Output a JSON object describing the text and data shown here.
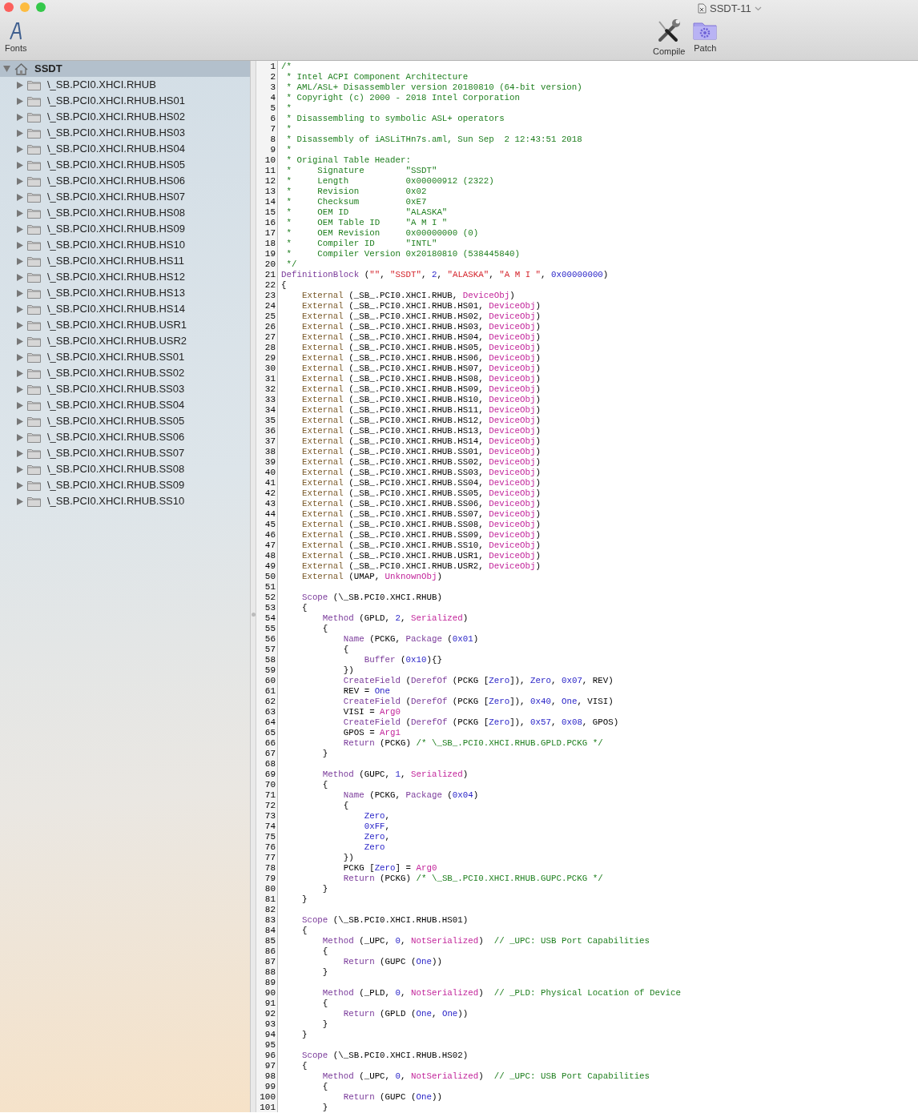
{
  "window": {
    "title": "SSDT-11"
  },
  "toolbar": {
    "left_items": [
      {
        "label": "Fonts",
        "kind": "fonts"
      }
    ],
    "right_items": [
      {
        "label": "Compile",
        "kind": "compile"
      },
      {
        "label": "Patch",
        "kind": "patch"
      }
    ]
  },
  "sidebar": {
    "tree": {
      "label": "SSDT",
      "expanded": true,
      "selected": true,
      "children": [
        {
          "label": "\\_SB.PCI0.XHCI.RHUB",
          "expanded": false,
          "selected": false
        },
        {
          "label": "\\_SB.PCI0.XHCI.RHUB.HS01",
          "expanded": false,
          "selected": false
        },
        {
          "label": "\\_SB.PCI0.XHCI.RHUB.HS02",
          "expanded": false,
          "selected": false
        },
        {
          "label": "\\_SB.PCI0.XHCI.RHUB.HS03",
          "expanded": false,
          "selected": false
        },
        {
          "label": "\\_SB.PCI0.XHCI.RHUB.HS04",
          "expanded": false,
          "selected": false
        },
        {
          "label": "\\_SB.PCI0.XHCI.RHUB.HS05",
          "expanded": false,
          "selected": false
        },
        {
          "label": "\\_SB.PCI0.XHCI.RHUB.HS06",
          "expanded": false,
          "selected": false
        },
        {
          "label": "\\_SB.PCI0.XHCI.RHUB.HS07",
          "expanded": false,
          "selected": false
        },
        {
          "label": "\\_SB.PCI0.XHCI.RHUB.HS08",
          "expanded": false,
          "selected": false
        },
        {
          "label": "\\_SB.PCI0.XHCI.RHUB.HS09",
          "expanded": false,
          "selected": false
        },
        {
          "label": "\\_SB.PCI0.XHCI.RHUB.HS10",
          "expanded": false,
          "selected": false
        },
        {
          "label": "\\_SB.PCI0.XHCI.RHUB.HS11",
          "expanded": false,
          "selected": false
        },
        {
          "label": "\\_SB.PCI0.XHCI.RHUB.HS12",
          "expanded": false,
          "selected": false
        },
        {
          "label": "\\_SB.PCI0.XHCI.RHUB.HS13",
          "expanded": false,
          "selected": false
        },
        {
          "label": "\\_SB.PCI0.XHCI.RHUB.HS14",
          "expanded": false,
          "selected": false
        },
        {
          "label": "\\_SB.PCI0.XHCI.RHUB.USR1",
          "expanded": false,
          "selected": false
        },
        {
          "label": "\\_SB.PCI0.XHCI.RHUB.USR2",
          "expanded": false,
          "selected": false
        },
        {
          "label": "\\_SB.PCI0.XHCI.RHUB.SS01",
          "expanded": false,
          "selected": false
        },
        {
          "label": "\\_SB.PCI0.XHCI.RHUB.SS02",
          "expanded": false,
          "selected": false
        },
        {
          "label": "\\_SB.PCI0.XHCI.RHUB.SS03",
          "expanded": false,
          "selected": false
        },
        {
          "label": "\\_SB.PCI0.XHCI.RHUB.SS04",
          "expanded": false,
          "selected": false
        },
        {
          "label": "\\_SB.PCI0.XHCI.RHUB.SS05",
          "expanded": false,
          "selected": false
        },
        {
          "label": "\\_SB.PCI0.XHCI.RHUB.SS06",
          "expanded": false,
          "selected": false
        },
        {
          "label": "\\_SB.PCI0.XHCI.RHUB.SS07",
          "expanded": false,
          "selected": false
        },
        {
          "label": "\\_SB.PCI0.XHCI.RHUB.SS08",
          "expanded": false,
          "selected": false
        },
        {
          "label": "\\_SB.PCI0.XHCI.RHUB.SS09",
          "expanded": false,
          "selected": false
        },
        {
          "label": "\\_SB.PCI0.XHCI.RHUB.SS10",
          "expanded": false,
          "selected": false
        }
      ]
    }
  },
  "editor": {
    "lines": [
      {
        "number": "1",
        "tokens": [
          {
            "kind": "comment",
            "text": "/*"
          }
        ]
      },
      {
        "number": "2",
        "tokens": [
          {
            "kind": "comment",
            "text": " * Intel ACPI Component Architecture"
          }
        ]
      },
      {
        "number": "3",
        "tokens": [
          {
            "kind": "comment",
            "text": " * AML/ASL+ Disassembler version 20180810 (64-bit version)"
          }
        ]
      },
      {
        "number": "4",
        "tokens": [
          {
            "kind": "comment",
            "text": " * Copyright (c) 2000 - 2018 Intel Corporation"
          }
        ]
      },
      {
        "number": "5",
        "tokens": [
          {
            "kind": "comment",
            "text": " *"
          }
        ]
      },
      {
        "number": "6",
        "tokens": [
          {
            "kind": "comment",
            "text": " * Disassembling to symbolic ASL+ operators"
          }
        ]
      },
      {
        "number": "7",
        "tokens": [
          {
            "kind": "comment",
            "text": " *"
          }
        ]
      },
      {
        "number": "8",
        "tokens": [
          {
            "kind": "comment",
            "text": " * Disassembly of iASLiTHn7s.aml, Sun Sep  2 12:43:51 2018"
          }
        ]
      },
      {
        "number": "9",
        "tokens": [
          {
            "kind": "comment",
            "text": " *"
          }
        ]
      },
      {
        "number": "10",
        "tokens": [
          {
            "kind": "comment",
            "text": " * Original Table Header:"
          }
        ]
      },
      {
        "number": "11",
        "tokens": [
          {
            "kind": "comment",
            "text": " *     Signature        \"SSDT\""
          }
        ]
      },
      {
        "number": "12",
        "tokens": [
          {
            "kind": "comment",
            "text": " *     Length           0x00000912 (2322)"
          }
        ]
      },
      {
        "number": "13",
        "tokens": [
          {
            "kind": "comment",
            "text": " *     Revision         0x02"
          }
        ]
      },
      {
        "number": "14",
        "tokens": [
          {
            "kind": "comment",
            "text": " *     Checksum         0xE7"
          }
        ]
      },
      {
        "number": "15",
        "tokens": [
          {
            "kind": "comment",
            "text": " *     OEM ID           \"ALASKA\""
          }
        ]
      },
      {
        "number": "16",
        "tokens": [
          {
            "kind": "comment",
            "text": " *     OEM Table ID     \"A M I \""
          }
        ]
      },
      {
        "number": "17",
        "tokens": [
          {
            "kind": "comment",
            "text": " *     OEM Revision     0x00000000 (0)"
          }
        ]
      },
      {
        "number": "18",
        "tokens": [
          {
            "kind": "comment",
            "text": " *     Compiler ID      \"INTL\""
          }
        ]
      },
      {
        "number": "19",
        "tokens": [
          {
            "kind": "comment",
            "text": " *     Compiler Version 0x20180810 (538445840)"
          }
        ]
      },
      {
        "number": "20",
        "tokens": [
          {
            "kind": "comment",
            "text": " */"
          }
        ]
      },
      {
        "number": "21",
        "tokens": [
          {
            "kind": "keyword",
            "text": "DefinitionBlock"
          },
          {
            "kind": "plain",
            "text": " ("
          },
          {
            "kind": "string",
            "text": "\"\""
          },
          {
            "kind": "plain",
            "text": ", "
          },
          {
            "kind": "string",
            "text": "\"SSDT\""
          },
          {
            "kind": "plain",
            "text": ", "
          },
          {
            "kind": "number",
            "text": "2"
          },
          {
            "kind": "plain",
            "text": ", "
          },
          {
            "kind": "string",
            "text": "\"ALASKA\""
          },
          {
            "kind": "plain",
            "text": ", "
          },
          {
            "kind": "string",
            "text": "\"A M I \""
          },
          {
            "kind": "plain",
            "text": ", "
          },
          {
            "kind": "number",
            "text": "0x00000000"
          },
          {
            "kind": "plain",
            "text": ")"
          }
        ]
      },
      {
        "number": "22",
        "tokens": [
          {
            "kind": "plain",
            "text": "{"
          }
        ]
      },
      {
        "number": "23",
        "tokens": [
          {
            "kind": "directive",
            "text": "    External"
          },
          {
            "kind": "plain",
            "text": " (_SB_.PCI0.XHCI.RHUB, "
          },
          {
            "kind": "builtin",
            "text": "DeviceObj"
          },
          {
            "kind": "plain",
            "text": ")"
          }
        ]
      },
      {
        "number": "24",
        "tokens": [
          {
            "kind": "directive",
            "text": "    External"
          },
          {
            "kind": "plain",
            "text": " (_SB_.PCI0.XHCI.RHUB.HS01, "
          },
          {
            "kind": "builtin",
            "text": "DeviceObj"
          },
          {
            "kind": "plain",
            "text": ")"
          }
        ]
      },
      {
        "number": "25",
        "tokens": [
          {
            "kind": "directive",
            "text": "    External"
          },
          {
            "kind": "plain",
            "text": " (_SB_.PCI0.XHCI.RHUB.HS02, "
          },
          {
            "kind": "builtin",
            "text": "DeviceObj"
          },
          {
            "kind": "plain",
            "text": ")"
          }
        ]
      },
      {
        "number": "26",
        "tokens": [
          {
            "kind": "directive",
            "text": "    External"
          },
          {
            "kind": "plain",
            "text": " (_SB_.PCI0.XHCI.RHUB.HS03, "
          },
          {
            "kind": "builtin",
            "text": "DeviceObj"
          },
          {
            "kind": "plain",
            "text": ")"
          }
        ]
      },
      {
        "number": "27",
        "tokens": [
          {
            "kind": "directive",
            "text": "    External"
          },
          {
            "kind": "plain",
            "text": " (_SB_.PCI0.XHCI.RHUB.HS04, "
          },
          {
            "kind": "builtin",
            "text": "DeviceObj"
          },
          {
            "kind": "plain",
            "text": ")"
          }
        ]
      },
      {
        "number": "28",
        "tokens": [
          {
            "kind": "directive",
            "text": "    External"
          },
          {
            "kind": "plain",
            "text": " (_SB_.PCI0.XHCI.RHUB.HS05, "
          },
          {
            "kind": "builtin",
            "text": "DeviceObj"
          },
          {
            "kind": "plain",
            "text": ")"
          }
        ]
      },
      {
        "number": "29",
        "tokens": [
          {
            "kind": "directive",
            "text": "    External"
          },
          {
            "kind": "plain",
            "text": " (_SB_.PCI0.XHCI.RHUB.HS06, "
          },
          {
            "kind": "builtin",
            "text": "DeviceObj"
          },
          {
            "kind": "plain",
            "text": ")"
          }
        ]
      },
      {
        "number": "30",
        "tokens": [
          {
            "kind": "directive",
            "text": "    External"
          },
          {
            "kind": "plain",
            "text": " (_SB_.PCI0.XHCI.RHUB.HS07, "
          },
          {
            "kind": "builtin",
            "text": "DeviceObj"
          },
          {
            "kind": "plain",
            "text": ")"
          }
        ]
      },
      {
        "number": "31",
        "tokens": [
          {
            "kind": "directive",
            "text": "    External"
          },
          {
            "kind": "plain",
            "text": " (_SB_.PCI0.XHCI.RHUB.HS08, "
          },
          {
            "kind": "builtin",
            "text": "DeviceObj"
          },
          {
            "kind": "plain",
            "text": ")"
          }
        ]
      },
      {
        "number": "32",
        "tokens": [
          {
            "kind": "directive",
            "text": "    External"
          },
          {
            "kind": "plain",
            "text": " (_SB_.PCI0.XHCI.RHUB.HS09, "
          },
          {
            "kind": "builtin",
            "text": "DeviceObj"
          },
          {
            "kind": "plain",
            "text": ")"
          }
        ]
      },
      {
        "number": "33",
        "tokens": [
          {
            "kind": "directive",
            "text": "    External"
          },
          {
            "kind": "plain",
            "text": " (_SB_.PCI0.XHCI.RHUB.HS10, "
          },
          {
            "kind": "builtin",
            "text": "DeviceObj"
          },
          {
            "kind": "plain",
            "text": ")"
          }
        ]
      },
      {
        "number": "34",
        "tokens": [
          {
            "kind": "directive",
            "text": "    External"
          },
          {
            "kind": "plain",
            "text": " (_SB_.PCI0.XHCI.RHUB.HS11, "
          },
          {
            "kind": "builtin",
            "text": "DeviceObj"
          },
          {
            "kind": "plain",
            "text": ")"
          }
        ]
      },
      {
        "number": "35",
        "tokens": [
          {
            "kind": "directive",
            "text": "    External"
          },
          {
            "kind": "plain",
            "text": " (_SB_.PCI0.XHCI.RHUB.HS12, "
          },
          {
            "kind": "builtin",
            "text": "DeviceObj"
          },
          {
            "kind": "plain",
            "text": ")"
          }
        ]
      },
      {
        "number": "36",
        "tokens": [
          {
            "kind": "directive",
            "text": "    External"
          },
          {
            "kind": "plain",
            "text": " (_SB_.PCI0.XHCI.RHUB.HS13, "
          },
          {
            "kind": "builtin",
            "text": "DeviceObj"
          },
          {
            "kind": "plain",
            "text": ")"
          }
        ]
      },
      {
        "number": "37",
        "tokens": [
          {
            "kind": "directive",
            "text": "    External"
          },
          {
            "kind": "plain",
            "text": " (_SB_.PCI0.XHCI.RHUB.HS14, "
          },
          {
            "kind": "builtin",
            "text": "DeviceObj"
          },
          {
            "kind": "plain",
            "text": ")"
          }
        ]
      },
      {
        "number": "38",
        "tokens": [
          {
            "kind": "directive",
            "text": "    External"
          },
          {
            "kind": "plain",
            "text": " (_SB_.PCI0.XHCI.RHUB.SS01, "
          },
          {
            "kind": "builtin",
            "text": "DeviceObj"
          },
          {
            "kind": "plain",
            "text": ")"
          }
        ]
      },
      {
        "number": "39",
        "tokens": [
          {
            "kind": "directive",
            "text": "    External"
          },
          {
            "kind": "plain",
            "text": " (_SB_.PCI0.XHCI.RHUB.SS02, "
          },
          {
            "kind": "builtin",
            "text": "DeviceObj"
          },
          {
            "kind": "plain",
            "text": ")"
          }
        ]
      },
      {
        "number": "40",
        "tokens": [
          {
            "kind": "directive",
            "text": "    External"
          },
          {
            "kind": "plain",
            "text": " (_SB_.PCI0.XHCI.RHUB.SS03, "
          },
          {
            "kind": "builtin",
            "text": "DeviceObj"
          },
          {
            "kind": "plain",
            "text": ")"
          }
        ]
      },
      {
        "number": "41",
        "tokens": [
          {
            "kind": "directive",
            "text": "    External"
          },
          {
            "kind": "plain",
            "text": " (_SB_.PCI0.XHCI.RHUB.SS04, "
          },
          {
            "kind": "builtin",
            "text": "DeviceObj"
          },
          {
            "kind": "plain",
            "text": ")"
          }
        ]
      },
      {
        "number": "42",
        "tokens": [
          {
            "kind": "directive",
            "text": "    External"
          },
          {
            "kind": "plain",
            "text": " (_SB_.PCI0.XHCI.RHUB.SS05, "
          },
          {
            "kind": "builtin",
            "text": "DeviceObj"
          },
          {
            "kind": "plain",
            "text": ")"
          }
        ]
      },
      {
        "number": "43",
        "tokens": [
          {
            "kind": "directive",
            "text": "    External"
          },
          {
            "kind": "plain",
            "text": " (_SB_.PCI0.XHCI.RHUB.SS06, "
          },
          {
            "kind": "builtin",
            "text": "DeviceObj"
          },
          {
            "kind": "plain",
            "text": ")"
          }
        ]
      },
      {
        "number": "44",
        "tokens": [
          {
            "kind": "directive",
            "text": "    External"
          },
          {
            "kind": "plain",
            "text": " (_SB_.PCI0.XHCI.RHUB.SS07, "
          },
          {
            "kind": "builtin",
            "text": "DeviceObj"
          },
          {
            "kind": "plain",
            "text": ")"
          }
        ]
      },
      {
        "number": "45",
        "tokens": [
          {
            "kind": "directive",
            "text": "    External"
          },
          {
            "kind": "plain",
            "text": " (_SB_.PCI0.XHCI.RHUB.SS08, "
          },
          {
            "kind": "builtin",
            "text": "DeviceObj"
          },
          {
            "kind": "plain",
            "text": ")"
          }
        ]
      },
      {
        "number": "46",
        "tokens": [
          {
            "kind": "directive",
            "text": "    External"
          },
          {
            "kind": "plain",
            "text": " (_SB_.PCI0.XHCI.RHUB.SS09, "
          },
          {
            "kind": "builtin",
            "text": "DeviceObj"
          },
          {
            "kind": "plain",
            "text": ")"
          }
        ]
      },
      {
        "number": "47",
        "tokens": [
          {
            "kind": "directive",
            "text": "    External"
          },
          {
            "kind": "plain",
            "text": " (_SB_.PCI0.XHCI.RHUB.SS10, "
          },
          {
            "kind": "builtin",
            "text": "DeviceObj"
          },
          {
            "kind": "plain",
            "text": ")"
          }
        ]
      },
      {
        "number": "48",
        "tokens": [
          {
            "kind": "directive",
            "text": "    External"
          },
          {
            "kind": "plain",
            "text": " (_SB_.PCI0.XHCI.RHUB.USR1, "
          },
          {
            "kind": "builtin",
            "text": "DeviceObj"
          },
          {
            "kind": "plain",
            "text": ")"
          }
        ]
      },
      {
        "number": "49",
        "tokens": [
          {
            "kind": "directive",
            "text": "    External"
          },
          {
            "kind": "plain",
            "text": " (_SB_.PCI0.XHCI.RHUB.USR2, "
          },
          {
            "kind": "builtin",
            "text": "DeviceObj"
          },
          {
            "kind": "plain",
            "text": ")"
          }
        ]
      },
      {
        "number": "50",
        "tokens": [
          {
            "kind": "directive",
            "text": "    External"
          },
          {
            "kind": "plain",
            "text": " (UMAP, "
          },
          {
            "kind": "builtin",
            "text": "UnknownObj"
          },
          {
            "kind": "plain",
            "text": ")"
          }
        ]
      },
      {
        "number": "51"
      },
      {
        "number": "52",
        "tokens": [
          {
            "kind": "keyword",
            "text": "    Scope"
          },
          {
            "kind": "plain",
            "text": " (\\_SB.PCI0.XHCI.RHUB)"
          }
        ]
      },
      {
        "number": "53",
        "tokens": [
          {
            "kind": "plain",
            "text": "    {"
          }
        ]
      },
      {
        "number": "54",
        "tokens": [
          {
            "kind": "keyword",
            "text": "        Method"
          },
          {
            "kind": "plain",
            "text": " (GPLD, "
          },
          {
            "kind": "number",
            "text": "2"
          },
          {
            "kind": "plain",
            "text": ", "
          },
          {
            "kind": "builtin",
            "text": "Serialized"
          },
          {
            "kind": "plain",
            "text": ")"
          }
        ]
      },
      {
        "number": "55",
        "tokens": [
          {
            "kind": "plain",
            "text": "        {"
          }
        ]
      },
      {
        "number": "56",
        "tokens": [
          {
            "kind": "keyword",
            "text": "            Name"
          },
          {
            "kind": "plain",
            "text": " (PCKG, "
          },
          {
            "kind": "keyword",
            "text": "Package"
          },
          {
            "kind": "plain",
            "text": " ("
          },
          {
            "kind": "number",
            "text": "0x01"
          },
          {
            "kind": "plain",
            "text": ")"
          }
        ]
      },
      {
        "number": "57",
        "tokens": [
          {
            "kind": "plain",
            "text": "            {"
          }
        ]
      },
      {
        "number": "58",
        "tokens": [
          {
            "kind": "keyword",
            "text": "                Buffer"
          },
          {
            "kind": "plain",
            "text": " ("
          },
          {
            "kind": "number",
            "text": "0x10"
          },
          {
            "kind": "plain",
            "text": "){}"
          }
        ]
      },
      {
        "number": "59",
        "tokens": [
          {
            "kind": "plain",
            "text": "            })"
          }
        ]
      },
      {
        "number": "60",
        "tokens": [
          {
            "kind": "keyword",
            "text": "            CreateField"
          },
          {
            "kind": "plain",
            "text": " ("
          },
          {
            "kind": "keyword",
            "text": "DerefOf"
          },
          {
            "kind": "plain",
            "text": " (PCKG ["
          },
          {
            "kind": "number",
            "text": "Zero"
          },
          {
            "kind": "plain",
            "text": "]), "
          },
          {
            "kind": "number",
            "text": "Zero"
          },
          {
            "kind": "plain",
            "text": ", "
          },
          {
            "kind": "number",
            "text": "0x07"
          },
          {
            "kind": "plain",
            "text": ", REV)"
          }
        ]
      },
      {
        "number": "61",
        "tokens": [
          {
            "kind": "plain",
            "text": "            REV = "
          },
          {
            "kind": "number",
            "text": "One"
          }
        ]
      },
      {
        "number": "62",
        "tokens": [
          {
            "kind": "keyword",
            "text": "            CreateField"
          },
          {
            "kind": "plain",
            "text": " ("
          },
          {
            "kind": "keyword",
            "text": "DerefOf"
          },
          {
            "kind": "plain",
            "text": " (PCKG ["
          },
          {
            "kind": "number",
            "text": "Zero"
          },
          {
            "kind": "plain",
            "text": "]), "
          },
          {
            "kind": "number",
            "text": "0x40"
          },
          {
            "kind": "plain",
            "text": ", "
          },
          {
            "kind": "number",
            "text": "One"
          },
          {
            "kind": "plain",
            "text": ", VISI)"
          }
        ]
      },
      {
        "number": "63",
        "tokens": [
          {
            "kind": "plain",
            "text": "            VISI = "
          },
          {
            "kind": "builtin",
            "text": "Arg0"
          }
        ]
      },
      {
        "number": "64",
        "tokens": [
          {
            "kind": "keyword",
            "text": "            CreateField"
          },
          {
            "kind": "plain",
            "text": " ("
          },
          {
            "kind": "keyword",
            "text": "DerefOf"
          },
          {
            "kind": "plain",
            "text": " (PCKG ["
          },
          {
            "kind": "number",
            "text": "Zero"
          },
          {
            "kind": "plain",
            "text": "]), "
          },
          {
            "kind": "number",
            "text": "0x57"
          },
          {
            "kind": "plain",
            "text": ", "
          },
          {
            "kind": "number",
            "text": "0x08"
          },
          {
            "kind": "plain",
            "text": ", GPOS)"
          }
        ]
      },
      {
        "number": "65",
        "tokens": [
          {
            "kind": "plain",
            "text": "            GPOS = "
          },
          {
            "kind": "builtin",
            "text": "Arg1"
          }
        ]
      },
      {
        "number": "66",
        "tokens": [
          {
            "kind": "keyword",
            "text": "            Return"
          },
          {
            "kind": "plain",
            "text": " (PCKG) "
          },
          {
            "kind": "comment",
            "text": "/* \\_SB_.PCI0.XHCI.RHUB.GPLD.PCKG */"
          }
        ]
      },
      {
        "number": "67",
        "tokens": [
          {
            "kind": "plain",
            "text": "        }"
          }
        ]
      },
      {
        "number": "68"
      },
      {
        "number": "69",
        "tokens": [
          {
            "kind": "keyword",
            "text": "        Method"
          },
          {
            "kind": "plain",
            "text": " (GUPC, "
          },
          {
            "kind": "number",
            "text": "1"
          },
          {
            "kind": "plain",
            "text": ", "
          },
          {
            "kind": "builtin",
            "text": "Serialized"
          },
          {
            "kind": "plain",
            "text": ")"
          }
        ]
      },
      {
        "number": "70",
        "tokens": [
          {
            "kind": "plain",
            "text": "        {"
          }
        ]
      },
      {
        "number": "71",
        "tokens": [
          {
            "kind": "keyword",
            "text": "            Name"
          },
          {
            "kind": "plain",
            "text": " (PCKG, "
          },
          {
            "kind": "keyword",
            "text": "Package"
          },
          {
            "kind": "plain",
            "text": " ("
          },
          {
            "kind": "number",
            "text": "0x04"
          },
          {
            "kind": "plain",
            "text": ")"
          }
        ]
      },
      {
        "number": "72",
        "tokens": [
          {
            "kind": "plain",
            "text": "            {"
          }
        ]
      },
      {
        "number": "73",
        "tokens": [
          {
            "kind": "number",
            "text": "                Zero"
          },
          {
            "kind": "plain",
            "text": ","
          }
        ]
      },
      {
        "number": "74",
        "tokens": [
          {
            "kind": "number",
            "text": "                0xFF"
          },
          {
            "kind": "plain",
            "text": ","
          }
        ]
      },
      {
        "number": "75",
        "tokens": [
          {
            "kind": "number",
            "text": "                Zero"
          },
          {
            "kind": "plain",
            "text": ","
          }
        ]
      },
      {
        "number": "76",
        "tokens": [
          {
            "kind": "number",
            "text": "                Zero"
          }
        ]
      },
      {
        "number": "77",
        "tokens": [
          {
            "kind": "plain",
            "text": "            })"
          }
        ]
      },
      {
        "number": "78",
        "tokens": [
          {
            "kind": "plain",
            "text": "            PCKG ["
          },
          {
            "kind": "number",
            "text": "Zero"
          },
          {
            "kind": "plain",
            "text": "] = "
          },
          {
            "kind": "builtin",
            "text": "Arg0"
          }
        ]
      },
      {
        "number": "79",
        "tokens": [
          {
            "kind": "keyword",
            "text": "            Return"
          },
          {
            "kind": "plain",
            "text": " (PCKG) "
          },
          {
            "kind": "comment",
            "text": "/* \\_SB_.PCI0.XHCI.RHUB.GUPC.PCKG */"
          }
        ]
      },
      {
        "number": "80",
        "tokens": [
          {
            "kind": "plain",
            "text": "        }"
          }
        ]
      },
      {
        "number": "81",
        "tokens": [
          {
            "kind": "plain",
            "text": "    }"
          }
        ]
      },
      {
        "number": "82"
      },
      {
        "number": "83",
        "tokens": [
          {
            "kind": "keyword",
            "text": "    Scope"
          },
          {
            "kind": "plain",
            "text": " (\\_SB.PCI0.XHCI.RHUB.HS01)"
          }
        ]
      },
      {
        "number": "84",
        "tokens": [
          {
            "kind": "plain",
            "text": "    {"
          }
        ]
      },
      {
        "number": "85",
        "tokens": [
          {
            "kind": "keyword",
            "text": "        Method"
          },
          {
            "kind": "plain",
            "text": " (_UPC, "
          },
          {
            "kind": "number",
            "text": "0"
          },
          {
            "kind": "plain",
            "text": ", "
          },
          {
            "kind": "builtin",
            "text": "NotSerialized"
          },
          {
            "kind": "plain",
            "text": ")  "
          },
          {
            "kind": "comment",
            "text": "// _UPC: USB Port Capabilities"
          }
        ]
      },
      {
        "number": "86",
        "tokens": [
          {
            "kind": "plain",
            "text": "        {"
          }
        ]
      },
      {
        "number": "87",
        "tokens": [
          {
            "kind": "keyword",
            "text": "            Return"
          },
          {
            "kind": "plain",
            "text": " (GUPC ("
          },
          {
            "kind": "number",
            "text": "One"
          },
          {
            "kind": "plain",
            "text": "))"
          }
        ]
      },
      {
        "number": "88",
        "tokens": [
          {
            "kind": "plain",
            "text": "        }"
          }
        ]
      },
      {
        "number": "89"
      },
      {
        "number": "90",
        "tokens": [
          {
            "kind": "keyword",
            "text": "        Method"
          },
          {
            "kind": "plain",
            "text": " (_PLD, "
          },
          {
            "kind": "number",
            "text": "0"
          },
          {
            "kind": "plain",
            "text": ", "
          },
          {
            "kind": "builtin",
            "text": "NotSerialized"
          },
          {
            "kind": "plain",
            "text": ")  "
          },
          {
            "kind": "comment",
            "text": "// _PLD: Physical Location of Device"
          }
        ]
      },
      {
        "number": "91",
        "tokens": [
          {
            "kind": "plain",
            "text": "        {"
          }
        ]
      },
      {
        "number": "92",
        "tokens": [
          {
            "kind": "keyword",
            "text": "            Return"
          },
          {
            "kind": "plain",
            "text": " (GPLD ("
          },
          {
            "kind": "number",
            "text": "One"
          },
          {
            "kind": "plain",
            "text": ", "
          },
          {
            "kind": "number",
            "text": "One"
          },
          {
            "kind": "plain",
            "text": "))"
          }
        ]
      },
      {
        "number": "93",
        "tokens": [
          {
            "kind": "plain",
            "text": "        }"
          }
        ]
      },
      {
        "number": "94",
        "tokens": [
          {
            "kind": "plain",
            "text": "    }"
          }
        ]
      },
      {
        "number": "95"
      },
      {
        "number": "96",
        "tokens": [
          {
            "kind": "keyword",
            "text": "    Scope"
          },
          {
            "kind": "plain",
            "text": " (\\_SB.PCI0.XHCI.RHUB.HS02)"
          }
        ]
      },
      {
        "number": "97",
        "tokens": [
          {
            "kind": "plain",
            "text": "    {"
          }
        ]
      },
      {
        "number": "98",
        "tokens": [
          {
            "kind": "keyword",
            "text": "        Method"
          },
          {
            "kind": "plain",
            "text": " (_UPC, "
          },
          {
            "kind": "number",
            "text": "0"
          },
          {
            "kind": "plain",
            "text": ", "
          },
          {
            "kind": "builtin",
            "text": "NotSerialized"
          },
          {
            "kind": "plain",
            "text": ")  "
          },
          {
            "kind": "comment",
            "text": "// _UPC: USB Port Capabilities"
          }
        ]
      },
      {
        "number": "99",
        "tokens": [
          {
            "kind": "plain",
            "text": "        {"
          }
        ]
      },
      {
        "number": "100",
        "tokens": [
          {
            "kind": "keyword",
            "text": "            Return"
          },
          {
            "kind": "plain",
            "text": " (GUPC ("
          },
          {
            "kind": "number",
            "text": "One"
          },
          {
            "kind": "plain",
            "text": "))"
          }
        ]
      },
      {
        "number": "101",
        "tokens": [
          {
            "kind": "plain",
            "text": "        }"
          }
        ]
      }
    ]
  }
}
